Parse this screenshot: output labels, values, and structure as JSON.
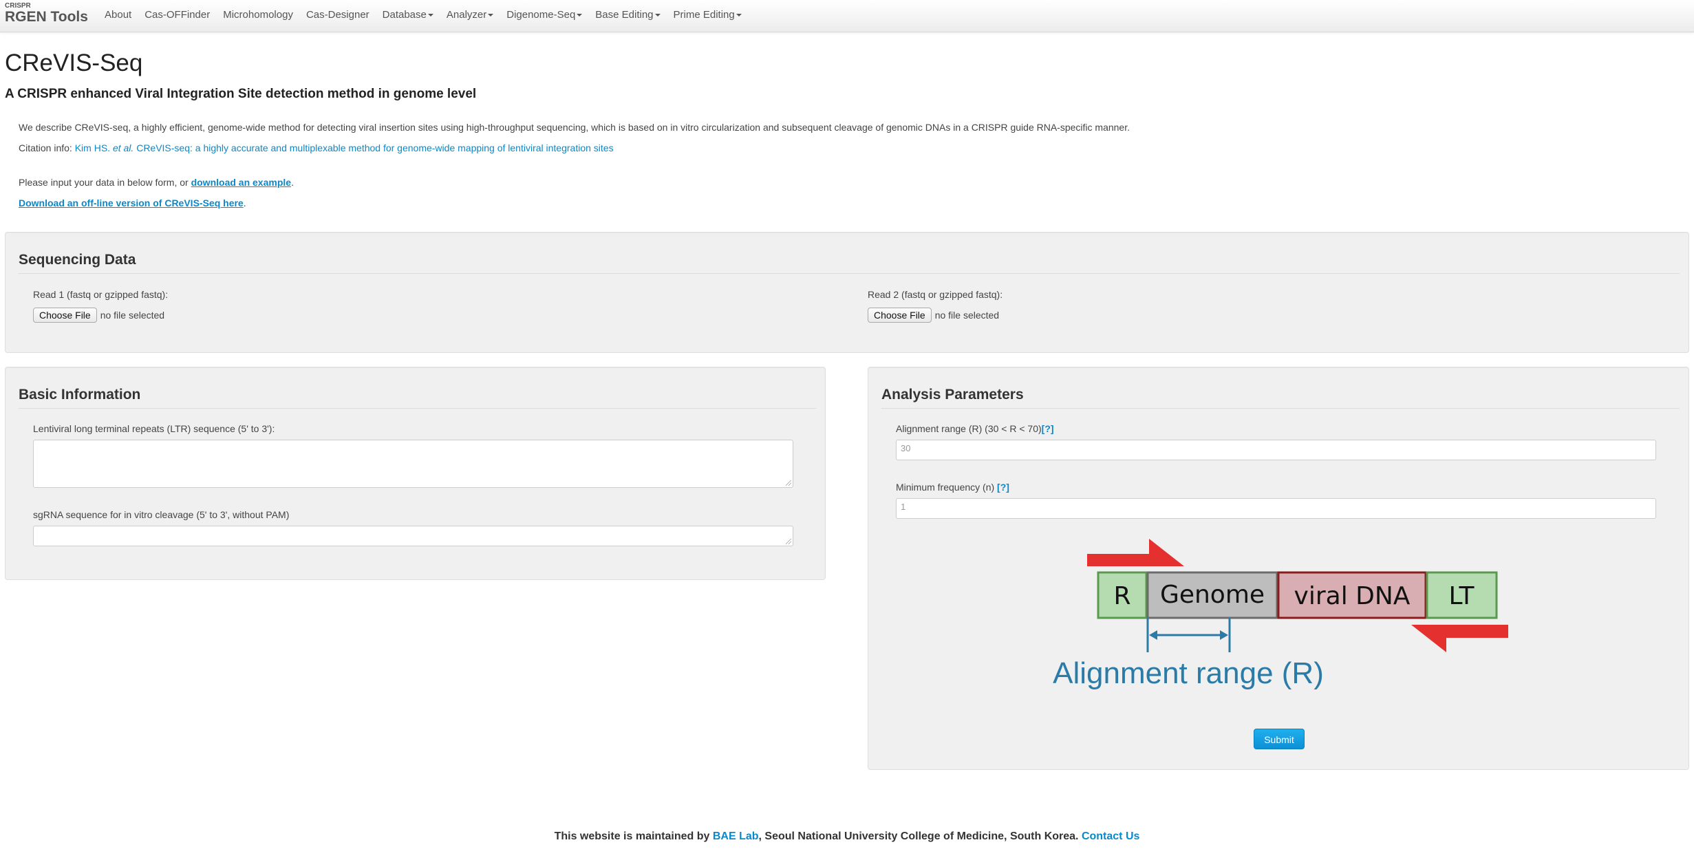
{
  "navbar": {
    "brand_small": "CRISPR",
    "brand_main": "RGEN Tools",
    "items": [
      {
        "label": "About",
        "dropdown": false
      },
      {
        "label": "Cas-OFFinder",
        "dropdown": false
      },
      {
        "label": "Microhomology",
        "dropdown": false
      },
      {
        "label": "Cas-Designer",
        "dropdown": false
      },
      {
        "label": "Database",
        "dropdown": true
      },
      {
        "label": "Analyzer",
        "dropdown": true
      },
      {
        "label": "Digenome-Seq",
        "dropdown": true
      },
      {
        "label": "Base Editing",
        "dropdown": true
      },
      {
        "label": "Prime Editing",
        "dropdown": true
      }
    ]
  },
  "page": {
    "title": "CReVIS-Seq",
    "subtitle": "A CRISPR enhanced Viral Integration Site detection method in genome level"
  },
  "intro": {
    "description": "We describe CReVIS-seq, a highly efficient, genome-wide method for detecting viral insertion sites using high-throughput sequencing, which is based on in vitro circularization and subsequent cleavage of genomic DNAs in a CRISPR guide RNA-specific manner.",
    "citation_label": "Citation info: ",
    "citation_authors": "Kim HS. ",
    "citation_etal": "et al.",
    "citation_title": " CReVIS-seq: a highly accurate and multiplexable method for genome-wide mapping of lentiviral integration sites",
    "input_prompt_prefix": "Please input your data in below form, or ",
    "download_example_label": "download an example",
    "input_prompt_suffix": ".",
    "offline_label": "Download an off-line version of CReVIS-Seq here",
    "offline_suffix": "."
  },
  "sequencing": {
    "heading": "Sequencing Data",
    "read1_label": "Read 1 (fastq or gzipped fastq):",
    "read2_label": "Read 2 (fastq or gzipped fastq):",
    "choose_file_label": "Choose File",
    "no_file_text": "no file selected"
  },
  "basic": {
    "heading": "Basic Information",
    "ltr_label": "Lentiviral long terminal repeats (LTR) sequence (5' to 3'):",
    "ltr_value": "",
    "sgrna_label": "sgRNA sequence for in vitro cleavage (5' to 3', without PAM)",
    "sgrna_value": ""
  },
  "analysis": {
    "heading": "Analysis Parameters",
    "alignment_label": "Alignment range (R) (30 < R < 70)",
    "alignment_placeholder": "30",
    "help_label": "[?]",
    "minfreq_label": "Minimum frequency (n) ",
    "minfreq_placeholder": "1",
    "submit_label": "Submit"
  },
  "diagram": {
    "box_r": "R",
    "box_genome": "Genome",
    "box_viral": "viral DNA",
    "box_lt": "LT",
    "caption": "Alignment range (R)",
    "colors": {
      "arrow": "#e53030",
      "green_fill": "#b5dcb0",
      "green_border": "#5a9a4e",
      "gray_fill": "#bdbdbd",
      "gray_border": "#6b6b6b",
      "pink_fill": "#d9aeb2",
      "pink_border": "#8a1c1c",
      "blue": "#2a7ba8"
    }
  },
  "footer": {
    "prefix": "This website is maintained by ",
    "lab": "BAE Lab",
    "middle": ", Seoul National University College of Medicine, South Korea. ",
    "contact": "Contact Us"
  }
}
